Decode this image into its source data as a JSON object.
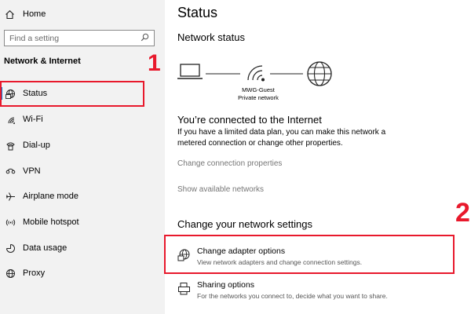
{
  "sidebar": {
    "home_label": "Home",
    "search_placeholder": "Find a setting",
    "section_title": "Network & Internet",
    "items": [
      {
        "label": "Status",
        "icon": "status-icon"
      },
      {
        "label": "Wi-Fi",
        "icon": "wifi-icon"
      },
      {
        "label": "Dial-up",
        "icon": "dialup-icon"
      },
      {
        "label": "VPN",
        "icon": "vpn-icon"
      },
      {
        "label": "Airplane mode",
        "icon": "airplane-icon"
      },
      {
        "label": "Mobile hotspot",
        "icon": "hotspot-icon"
      },
      {
        "label": "Data usage",
        "icon": "data-usage-icon"
      },
      {
        "label": "Proxy",
        "icon": "proxy-icon"
      }
    ]
  },
  "main": {
    "title": "Status",
    "network_status_heading": "Network status",
    "network_name": "MWG-Guest",
    "network_type": "Private network",
    "connected_title": "You’re connected to the Internet",
    "connected_body": "If you have a limited data plan, you can make this network a metered connection or change other properties.",
    "change_connection_link": "Change connection properties",
    "show_networks_link": "Show available networks",
    "change_settings_heading": "Change your network settings",
    "options": [
      {
        "title": "Change adapter options",
        "desc": "View network adapters and change connection settings.",
        "icon": "adapter-icon"
      },
      {
        "title": "Sharing options",
        "desc": "For the networks you connect to, decide what you want to share.",
        "icon": "sharing-icon"
      }
    ]
  },
  "annotations": {
    "marker_1": "1",
    "marker_2": "2"
  },
  "colors": {
    "highlight": "#e8192c",
    "accent": "#0078d4"
  }
}
